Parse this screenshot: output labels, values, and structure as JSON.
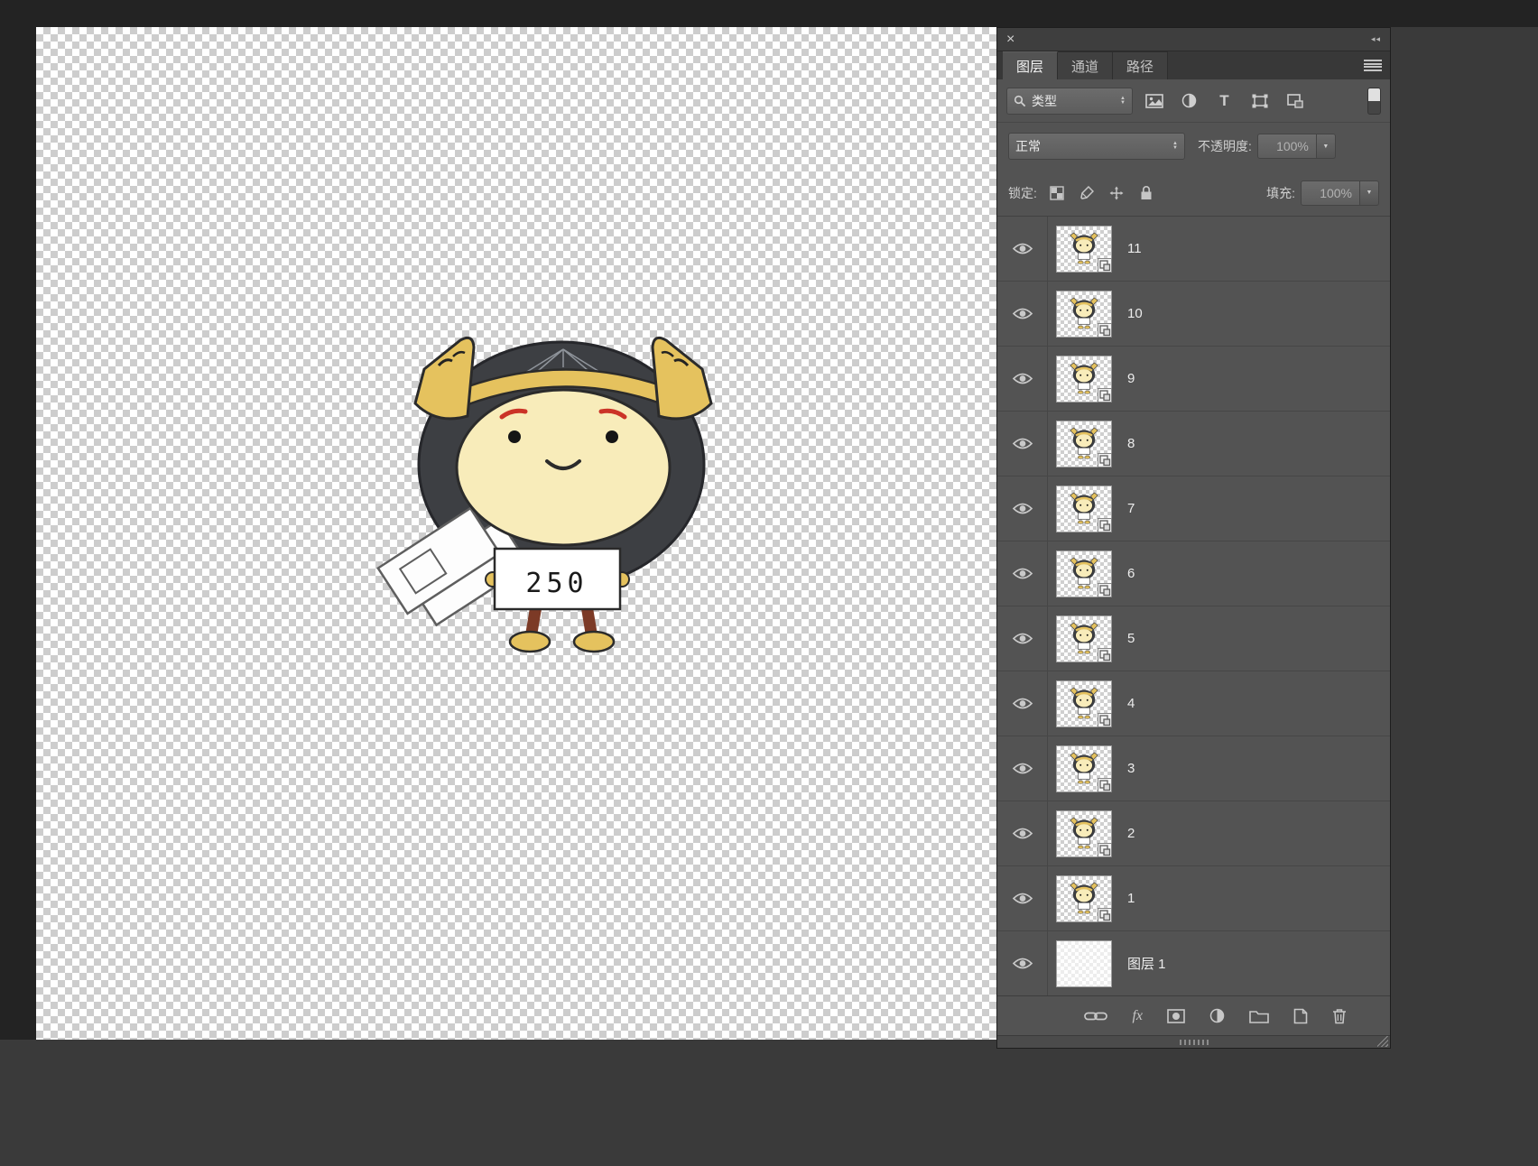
{
  "icons": {
    "close": "×",
    "collapse": "◂◂",
    "spinner_up": "▲",
    "spinner_down": "▼",
    "dropdown_arrow": "▼",
    "type_glyph": "T"
  },
  "panel": {
    "tabs": [
      {
        "label": "图层"
      },
      {
        "label": "通道"
      },
      {
        "label": "路径"
      }
    ],
    "filter": {
      "type_label": "类型"
    },
    "blend": {
      "mode": "正常",
      "opacity_label": "不透明度:",
      "opacity_value": "100%"
    },
    "lock": {
      "label": "锁定:",
      "fill_label": "填充:",
      "fill_value": "100%"
    },
    "layers": [
      {
        "name": "11"
      },
      {
        "name": "10"
      },
      {
        "name": "9"
      },
      {
        "name": "8"
      },
      {
        "name": "7"
      },
      {
        "name": "6"
      },
      {
        "name": "5"
      },
      {
        "name": "4"
      },
      {
        "name": "3"
      },
      {
        "name": "2"
      },
      {
        "name": "1"
      },
      {
        "name": "图层 1"
      }
    ],
    "toolbar": {
      "fx_label": "fx"
    }
  },
  "canvas": {
    "sign_text": "250"
  },
  "colors": {
    "panel_bg": "#535353",
    "accent_gold": "#e5c25e",
    "face": "#f8ecba",
    "hair": "#3d3f43"
  }
}
